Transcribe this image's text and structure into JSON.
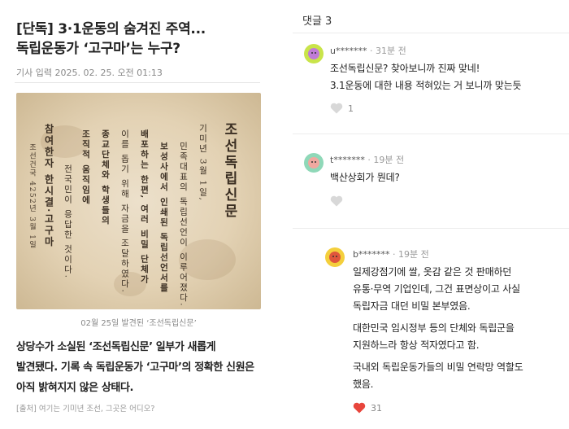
{
  "article": {
    "headline_line1": "[단독] 3·1운동의 숨겨진 주역...",
    "headline_line2": "독립운동가 ‘고구마’는 누구?",
    "dateline": "기사 입력 2025. 02. 25. 오전 01:13",
    "photo": {
      "title": "조선독립신문",
      "body_columns": [
        "기미년 3월 1일,",
        "민족대표의 독립선언이 이루어졌다.",
        "보성사에서 인쇄된 독립선언서를",
        "배포하는 한편, 여러 비밀 단체가",
        "이를 돕기 위해 자금을 조달하였다.",
        "종교단체와 학생들의",
        "조직적 움직임에",
        "전국민이 응답한 것이다."
      ],
      "bold_column": "참여한자 한시결·고구마",
      "date_column": "조선건국 4252년 3월 1일"
    },
    "caption": "02월 25일 발견된 ‘조선독립신문’",
    "lead_line1": "상당수가 소실된 ‘조선독립신문’ 일부가 새롭게",
    "lead_line2": "발견됐다. 기록 속 독립운동가 ‘고구마’의 정확한 신원은",
    "lead_line3": "아직 밝혀지지 않은 상태다.",
    "source": "[출처] 여기는 기미년 조선, 그곳은 어디오?"
  },
  "comments": {
    "count_label": "댓글 3",
    "items": [
      {
        "user": "u*******",
        "time": "31분 전",
        "lines": [
          "조선독립신문? 찾아보니까 진짜 맞네!",
          "3.1운동에 대한 내용 적혀있는 거 보니까 맞는듯"
        ],
        "likes": "1",
        "liked": false,
        "avatar_icon": "green-face-avatar",
        "avatar_color": "#c9e44a",
        "face_color": "#c07bd6"
      },
      {
        "user": "t*******",
        "time": "19분 전",
        "lines": [
          "백산상회가 뭔데?"
        ],
        "likes": "",
        "liked": false,
        "avatar_icon": "mint-face-avatar",
        "avatar_color": "#8fd8b8",
        "face_color": "#f1a8a0"
      },
      {
        "user": "b*******",
        "time": "19분 전",
        "paragraphs": [
          [
            "일제강점기에 쌀, 옷감 같은 것 판매하던",
            "유통·무역 기업인데, 그건 표면상이고 사실",
            "독립자금 대던 비밀 본부였음."
          ],
          [
            "대한민국 임시정부 등의 단체와 독립군을",
            "지원하느라 항상 적자였다고 함."
          ],
          [
            "국내외 독립운동가들의 비밀 연락망 역할도",
            "했음."
          ]
        ],
        "likes": "31",
        "liked": true,
        "avatar_icon": "yellow-face-avatar",
        "avatar_color": "#f4cf3c",
        "face_color": "#e0553c"
      }
    ]
  },
  "colors": {
    "like_active": "#e8453c",
    "like_inactive": "#d8d8d8",
    "divider": "#ececec"
  }
}
